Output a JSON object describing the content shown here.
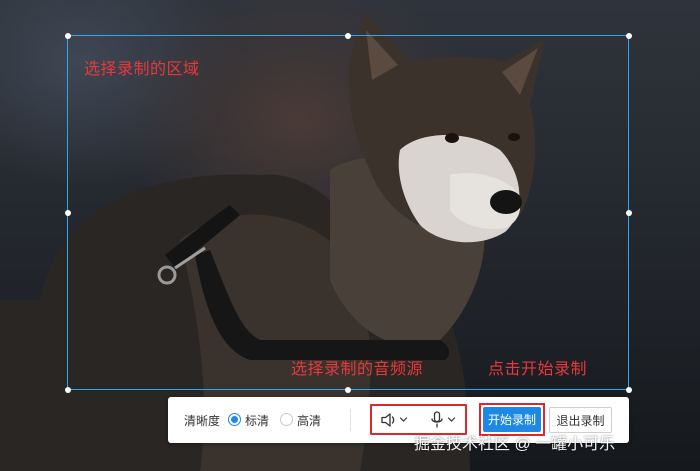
{
  "annotations": {
    "select_region": "选择录制的区域",
    "select_audio": "选择录制的音频源",
    "click_start": "点击开始录制"
  },
  "toolbar": {
    "quality_label": "清晰度",
    "option_standard": "标清",
    "option_high": "高清",
    "selected_quality": "标清",
    "start_label": "开始录制",
    "exit_label": "退出录制",
    "icons": [
      "speaker-icon",
      "chevron-down-icon",
      "microphone-icon",
      "chevron-down-icon"
    ]
  },
  "watermark": "掘金技术社区 @ 一罐小可乐",
  "colors": {
    "selection_border": "#2aa7f0",
    "annotation": "#e8383d",
    "highlight_box": "#e0262d",
    "primary": "#1e88e5"
  }
}
